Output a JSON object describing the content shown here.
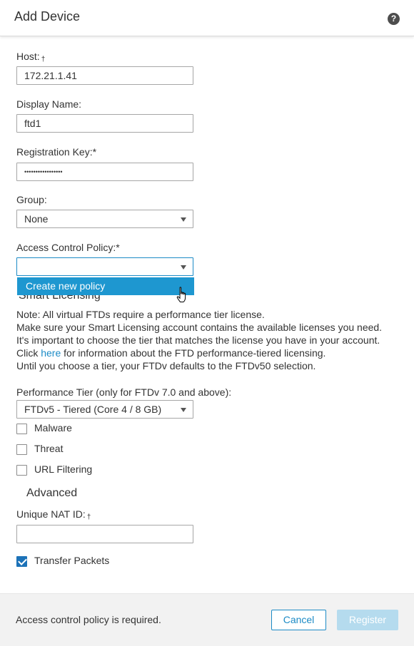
{
  "dialog": {
    "title": "Add Device",
    "help_glyph": "?"
  },
  "form": {
    "host": {
      "label": "Host:",
      "marker": "†",
      "value": "172.21.1.41"
    },
    "display_name": {
      "label": "Display Name:",
      "value": "ftd1"
    },
    "registration_key": {
      "label": "Registration Key:*",
      "value": "•••••••••••••••••"
    },
    "group": {
      "label": "Group:",
      "value": "None"
    },
    "access_control_policy": {
      "label": "Access Control Policy:*",
      "value": "",
      "dropdown_option": "Create new policy"
    },
    "smart_licensing": {
      "heading": "Smart Licensing",
      "note_lines": [
        "Note: All virtual FTDs require a performance tier license.",
        "Make sure your Smart Licensing account contains the available licenses you need.",
        "It's important to choose the tier that matches the license you have in your account."
      ],
      "click_prefix": "Click ",
      "click_link": "here",
      "click_suffix": " for information about the FTD performance-tiered licensing.",
      "last_line": "Until you choose a tier, your FTDv defaults to the FTDv50 selection."
    },
    "performance_tier": {
      "label": "Performance Tier (only for FTDv 7.0 and above):",
      "value": "FTDv5 - Tiered (Core 4 / 8 GB)"
    },
    "licenses": [
      {
        "label": "Malware",
        "checked": false
      },
      {
        "label": "Threat",
        "checked": false
      },
      {
        "label": "URL Filtering",
        "checked": false
      }
    ],
    "advanced_heading": "Advanced",
    "unique_nat_id": {
      "label": "Unique NAT ID:",
      "marker": "†",
      "value": ""
    },
    "transfer_packets": {
      "label": "Transfer Packets",
      "checked": true
    }
  },
  "footer": {
    "message": "Access control policy is required.",
    "cancel_label": "Cancel",
    "register_label": "Register"
  },
  "colors": {
    "accent": "#1c8bc6",
    "dropdown_highlight": "#1e97d0",
    "disabled_button": "#b5dbee"
  }
}
